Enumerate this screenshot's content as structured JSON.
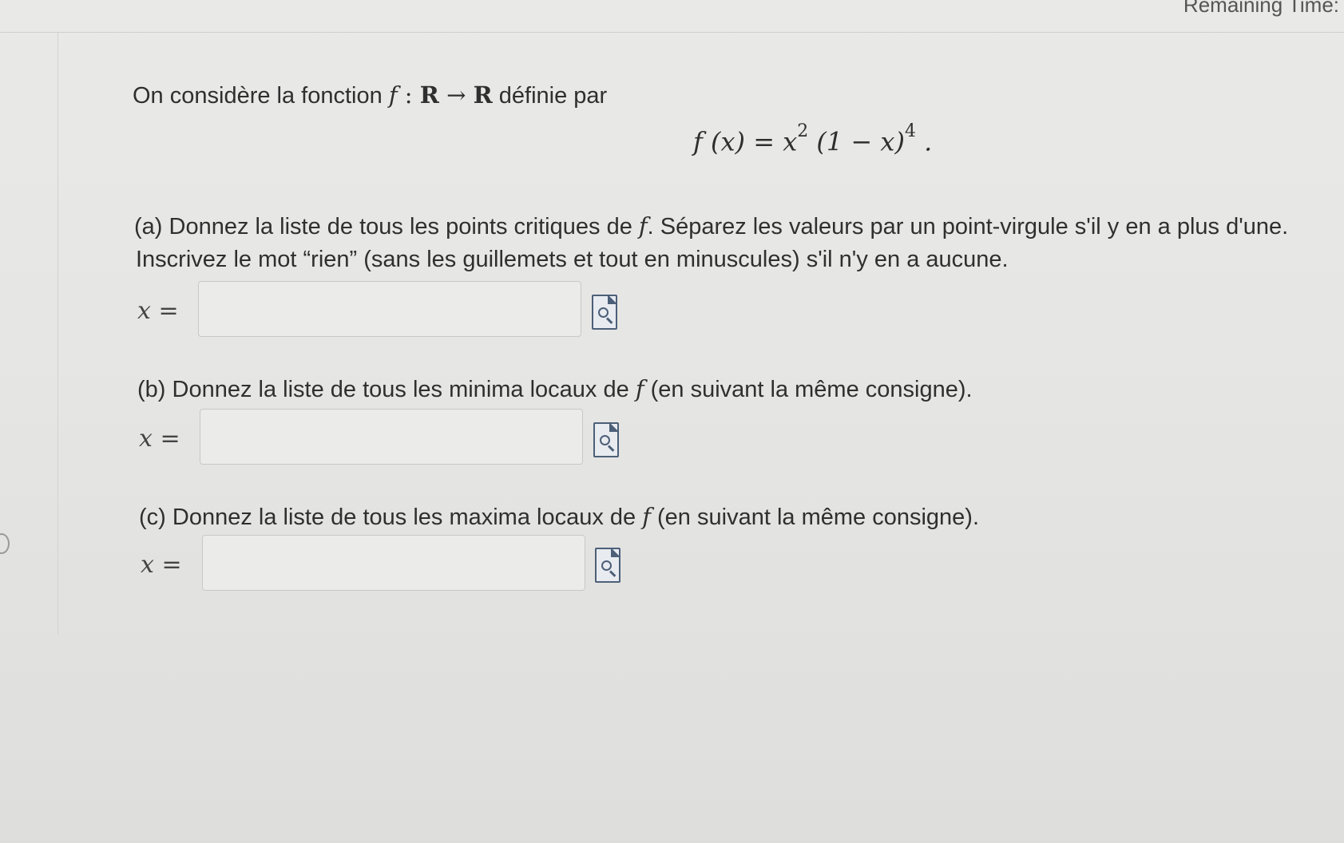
{
  "header": {
    "remaining_time_label": "Remaining Time:"
  },
  "intro": {
    "text_before": "On considère la fonction ",
    "f": "f",
    "colon": " : ",
    "R": "R",
    "arrow": " → ",
    "text_after": " définie par"
  },
  "formula": {
    "lhs": "f (x) = x",
    "exp1": "2",
    "mid": " (1 − x)",
    "exp2": "4",
    "end": " ."
  },
  "part_a": {
    "line1_before": "(a) Donnez la liste de tous les points critiques de ",
    "f": "f",
    "line1_after": ". Séparez les valeurs par un point-virgule s'il y en a plus d'une.",
    "line2": "Inscrivez le mot “rien” (sans les guillemets et tout en minuscules) s'il n'y en a aucune.",
    "x_label": "x =",
    "value": ""
  },
  "part_b": {
    "before": "(b) Donnez la liste de tous les minima locaux de ",
    "f": "f",
    "after": " (en suivant la même consigne).",
    "x_label": "x =",
    "value": ""
  },
  "part_c": {
    "before": "(c) Donnez la liste de tous les maxima locaux de ",
    "f": "f",
    "after": " (en suivant la même consigne).",
    "x_label": "x =",
    "value": ""
  },
  "icons": {
    "preview": "document-preview-icon"
  },
  "colors": {
    "icon_accent": "#4c5f78",
    "background": "#e7e7e5"
  }
}
